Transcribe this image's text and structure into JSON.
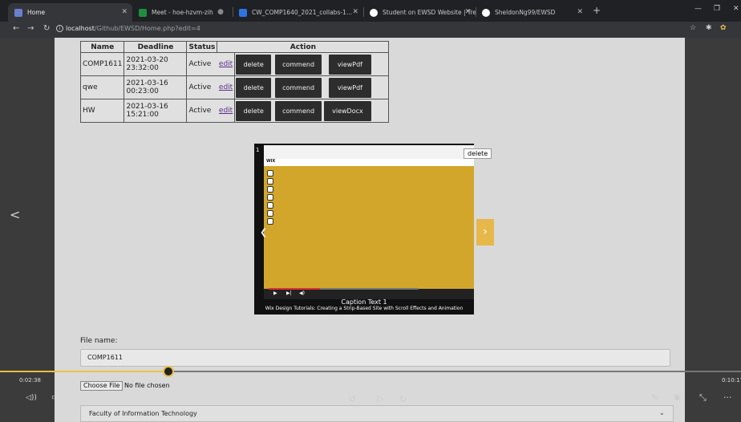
{
  "browser": {
    "tabs": [
      {
        "title": "Home",
        "active": true
      },
      {
        "title": "Meet - hoe-hzvm-zih",
        "active": false
      },
      {
        "title": "CW_COMP1640_2021_collabs-1...",
        "active": false
      },
      {
        "title": "Student on EWSD Website | Trell",
        "active": false
      },
      {
        "title": "SheldonNg99/EWSD",
        "active": false
      }
    ],
    "url_host": "localhost",
    "url_path": "/Github/EWSD/Home.php?edit=4"
  },
  "table": {
    "headers": [
      "Name",
      "Deadline",
      "Status",
      "Action"
    ],
    "rows": [
      {
        "name": "COMP1611",
        "deadline_date": "2021-03-20",
        "deadline_time": "23:32:00",
        "status": "Active",
        "edit": "edit",
        "btn1": "delete",
        "btn2": "commend",
        "btn3": "viewPdf"
      },
      {
        "name": "qwe",
        "deadline_date": "2021-03-16",
        "deadline_time": "00:23:00",
        "status": "Active",
        "edit": "edit",
        "btn1": "delete",
        "btn2": "commend",
        "btn3": "viewPdf"
      },
      {
        "name": "HW",
        "deadline_date": "2021-03-16",
        "deadline_time": "15:21:00",
        "status": "Active",
        "edit": "edit",
        "btn1": "delete",
        "btn2": "commend",
        "btn3": "viewDocx"
      }
    ]
  },
  "slideshow": {
    "number": "1",
    "delete_label": "delete",
    "caption": "Caption Text 1",
    "subtitle": "Wix Design Tutorials: Creating a Strip-Based Site with Scroll Effects and Animation",
    "wix_logo": "WIX"
  },
  "form": {
    "file_label": "File name:",
    "file_value": "COMP1611",
    "choose_file": "Choose File",
    "no_file": "No file chosen",
    "faculty": "Faculty of Information Technology"
  },
  "player": {
    "current_time": "0:02:38",
    "duration": "0:10:17",
    "progress": 0.227
  }
}
